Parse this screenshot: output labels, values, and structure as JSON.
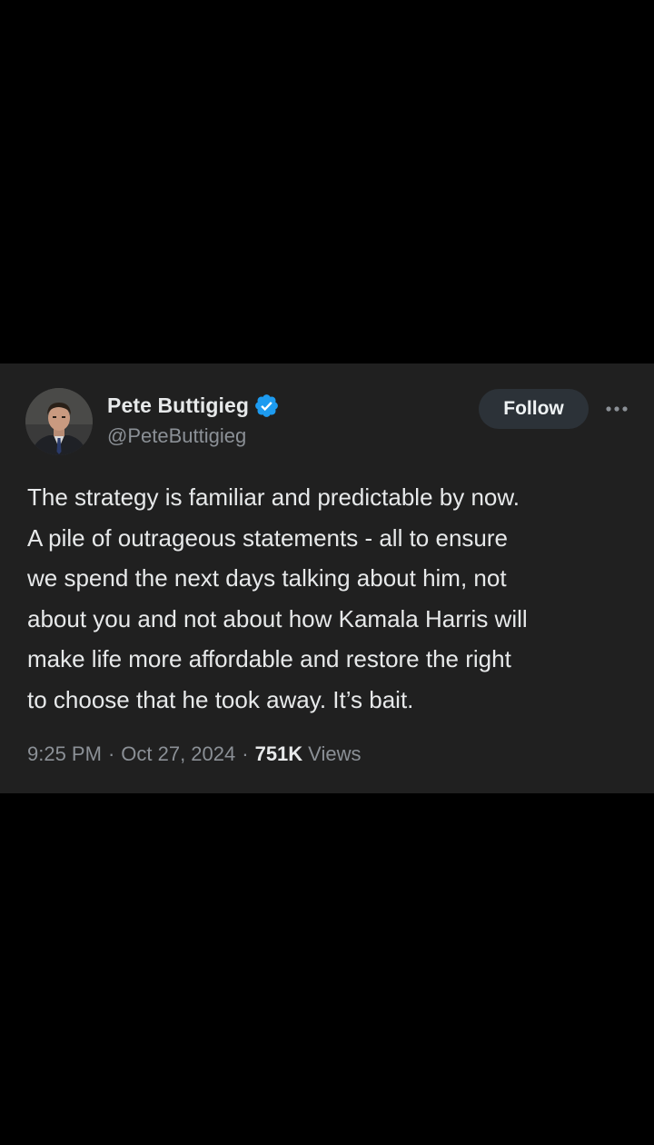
{
  "tweet": {
    "author": {
      "display_name": "Pete Buttigieg",
      "handle": "@PeteButtigieg",
      "verified": true,
      "verified_color": "#1d9bf0"
    },
    "follow_label": "Follow",
    "more_icon": "ellipsis-horizontal-icon",
    "text_lines": [
      "The strategy is familiar and predictable by now.",
      "A pile of outrageous statements - all to ensure",
      "we spend the next days talking about him, not",
      "about you and not about how Kamala Harris will",
      "make life more affordable and restore the right",
      "to choose that he took away. It’s bait."
    ],
    "time": "9:25 PM",
    "date": "Oct 27, 2024",
    "separator": "·",
    "views_count": "751K",
    "views_label": "Views"
  },
  "colors": {
    "page_background": "#000000",
    "card_background": "#202020",
    "primary_text": "#e7e9ea",
    "secondary_text": "#8b9096",
    "follow_button_bg": "#2c3238"
  }
}
